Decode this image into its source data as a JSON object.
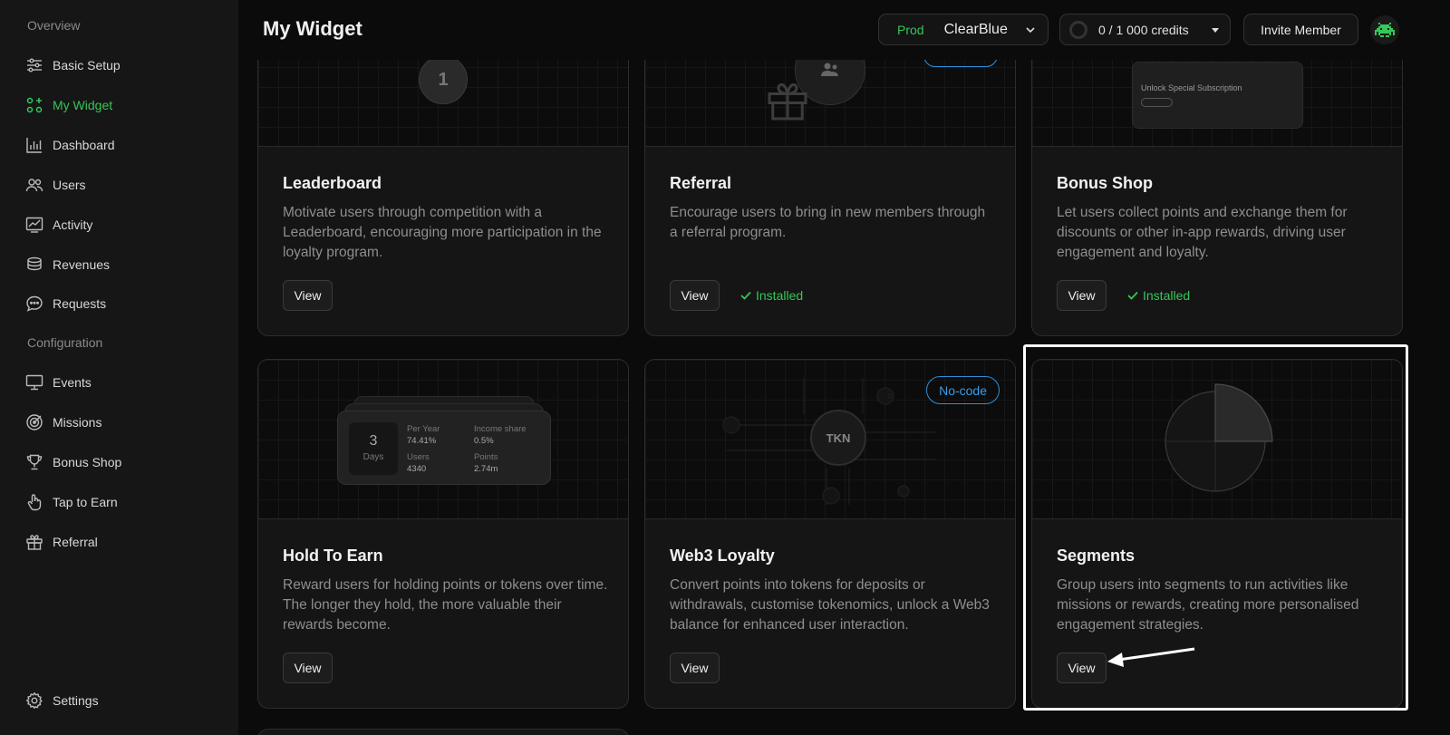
{
  "sidebar": {
    "section_overview": "Overview",
    "section_configuration": "Configuration",
    "items": [
      {
        "label": "Basic Setup",
        "icon": "sliders-icon"
      },
      {
        "label": "My Widget",
        "icon": "widget-grid-icon",
        "active": true
      },
      {
        "label": "Dashboard",
        "icon": "bar-chart-icon"
      },
      {
        "label": "Users",
        "icon": "users-icon"
      },
      {
        "label": "Activity",
        "icon": "activity-chart-icon"
      },
      {
        "label": "Revenues",
        "icon": "coins-icon"
      },
      {
        "label": "Requests",
        "icon": "chat-bubble-icon"
      }
    ],
    "config_items": [
      {
        "label": "Events",
        "icon": "monitor-icon"
      },
      {
        "label": "Missions",
        "icon": "target-icon"
      },
      {
        "label": "Bonus Shop",
        "icon": "trophy-icon"
      },
      {
        "label": "Tap to Earn",
        "icon": "tap-hand-icon"
      },
      {
        "label": "Referral",
        "icon": "gift-icon"
      }
    ],
    "settings": "Settings"
  },
  "header": {
    "title": "My Widget",
    "env_label": "Prod",
    "project": "ClearBlue",
    "credits": "0 / 1 000 credits",
    "invite": "Invite Member"
  },
  "cards": [
    {
      "title": "Leaderboard",
      "desc": "Motivate users through competition with a Leaderboard, encouraging more participation in the loyalty program.",
      "view": "View",
      "art_rank": "1"
    },
    {
      "title": "Referral",
      "desc": "Encourage users to bring in new members through a referral program.",
      "view": "View",
      "status": "Installed"
    },
    {
      "title": "Bonus Shop",
      "desc": "Let users collect points and exchange them for discounts or other in-app rewards, driving user engagement and loyalty.",
      "view": "View",
      "status": "Installed",
      "art_text": "Unlock Special Subscription"
    },
    {
      "title": "Hold To Earn",
      "desc": "Reward users for holding points or tokens over time. The longer they hold, the more valuable their rewards become.",
      "view": "View",
      "art": {
        "days_num": "3",
        "days_label": "Days",
        "per_year_label": "Per Year",
        "per_year": "74.41%",
        "income_label": "Income share",
        "income": "0.5%",
        "users_label": "Users",
        "users": "4340",
        "points_label": "Points",
        "points": "2.74m"
      }
    },
    {
      "title": "Web3 Loyalty",
      "desc": "Convert points into tokens for deposits or withdrawals, customise tokenomics, unlock a Web3 balance for enhanced user interaction.",
      "view": "View",
      "badge": "No-code",
      "art_token": "TKN"
    },
    {
      "title": "Segments",
      "desc": "Group users into segments to run activities like missions or rewards, creating more personalised engagement strategies.",
      "view": "View"
    }
  ],
  "colors": {
    "accent_green": "#35c759",
    "badge_blue": "#3b9be6",
    "highlight": "#ffffff"
  }
}
